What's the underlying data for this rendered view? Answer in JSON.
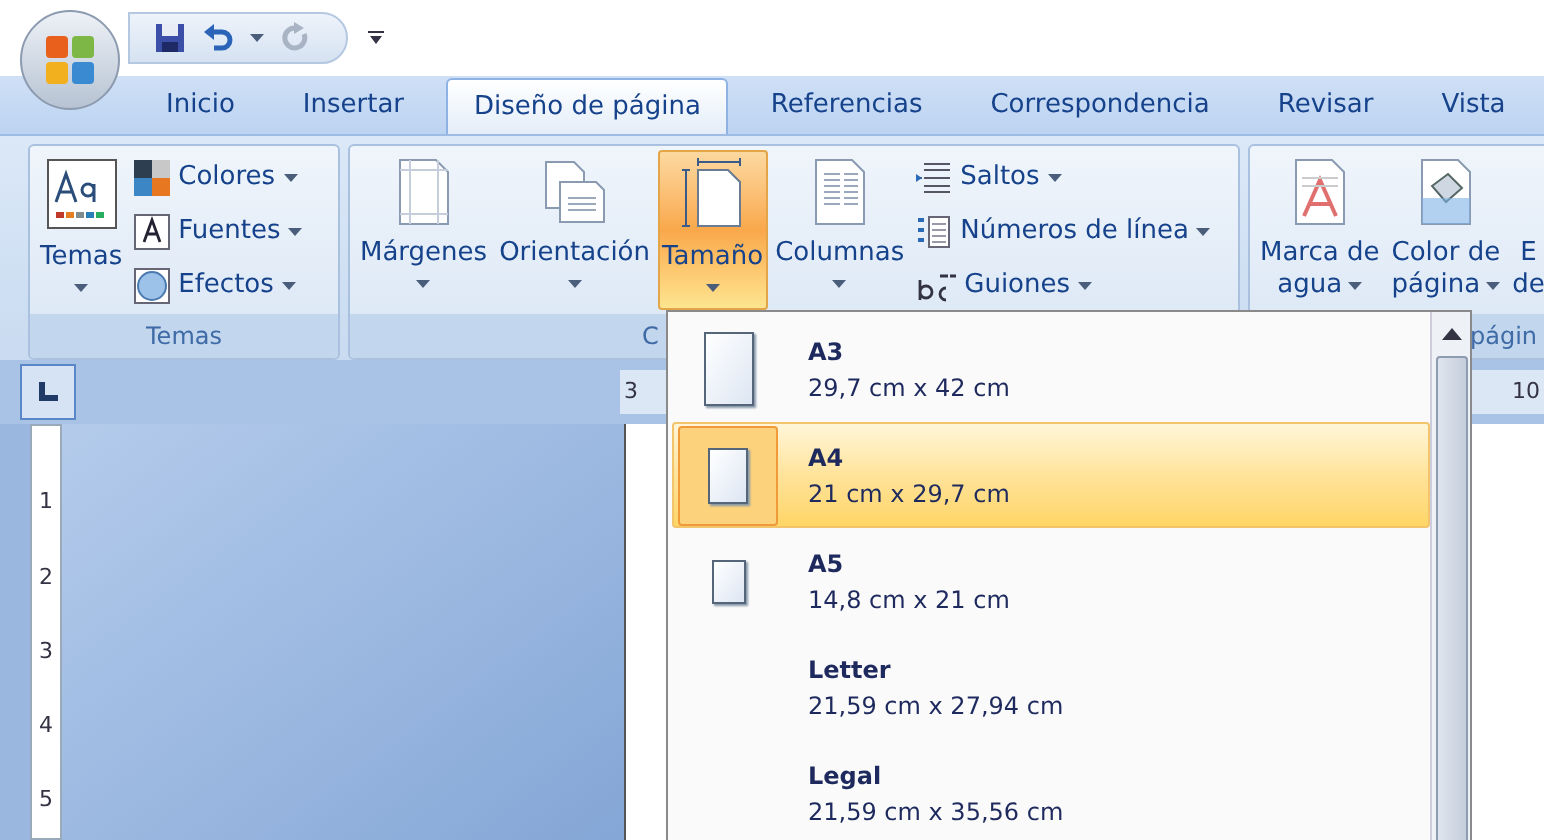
{
  "tabs": [
    {
      "label": "Inicio",
      "selected": false
    },
    {
      "label": "Insertar",
      "selected": false
    },
    {
      "label": "Diseño de página",
      "selected": true
    },
    {
      "label": "Referencias",
      "selected": false
    },
    {
      "label": "Correspondencia",
      "selected": false
    },
    {
      "label": "Revisar",
      "selected": false
    },
    {
      "label": "Vista",
      "selected": false
    }
  ],
  "ribbon": {
    "groups": [
      {
        "label": "Temas",
        "large_buttons": [
          {
            "lines": [
              "Temas"
            ],
            "caret": true,
            "pressed": false
          }
        ],
        "small_buttons": [
          {
            "label": "Colores"
          },
          {
            "label": "Fuentes"
          },
          {
            "label": "Efectos"
          }
        ]
      },
      {
        "label": "C",
        "large_buttons": [
          {
            "lines": [
              "Márgenes"
            ],
            "caret": true,
            "pressed": false
          },
          {
            "lines": [
              "Orientación"
            ],
            "caret": true,
            "pressed": false
          },
          {
            "lines": [
              "Tamaño"
            ],
            "caret": true,
            "pressed": true
          },
          {
            "lines": [
              "Columnas"
            ],
            "caret": true,
            "pressed": false
          }
        ],
        "small_buttons": [
          {
            "label": "Saltos"
          },
          {
            "label": "Números de línea"
          },
          {
            "label": "Guiones"
          }
        ]
      },
      {
        "label": "págin",
        "large_buttons": [
          {
            "lines": [
              "Marca de",
              "agua"
            ],
            "caret": true,
            "pressed": false
          },
          {
            "lines": [
              "Color de",
              "página"
            ],
            "caret": true,
            "pressed": false
          },
          {
            "lines": [
              "E",
              "de"
            ],
            "caret": false,
            "pressed": false
          }
        ]
      }
    ]
  },
  "ruler": {
    "h_numbers": [
      "3",
      "10"
    ],
    "v_numbers": [
      "1",
      "2",
      "3",
      "4",
      "5"
    ]
  },
  "size_menu": {
    "items": [
      {
        "name": "A3",
        "size": "29,7 cm x 42 cm",
        "kind": "large",
        "selected": false
      },
      {
        "name": "A4",
        "size": "21 cm x 29,7 cm",
        "kind": "medium",
        "selected": true
      },
      {
        "name": "A5",
        "size": "14,8 cm x 21 cm",
        "kind": "small",
        "selected": false
      },
      {
        "name": "Letter",
        "size": "21,59 cm x 27,94 cm",
        "kind": "none",
        "selected": false
      },
      {
        "name": "Legal",
        "size": "21,59 cm x 35,56 cm",
        "kind": "none",
        "selected": false
      }
    ]
  }
}
